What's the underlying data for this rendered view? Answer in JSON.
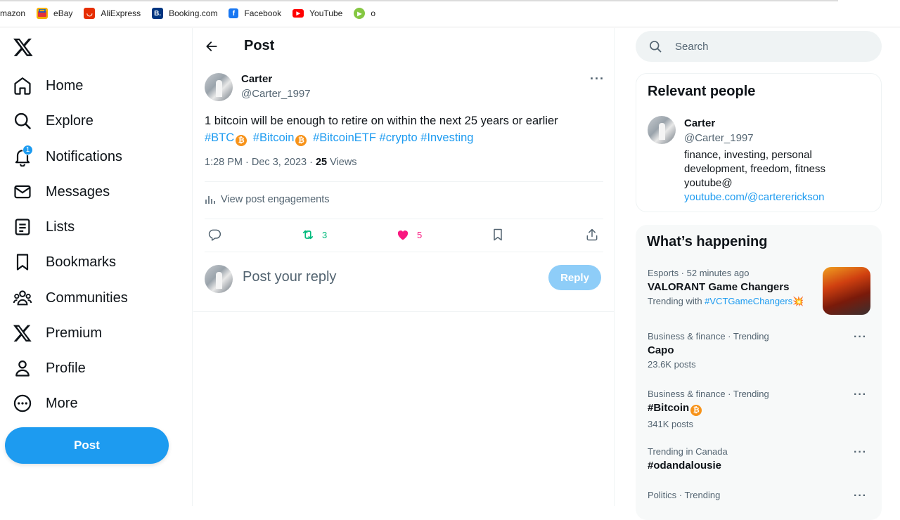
{
  "bookmarks_bar": {
    "items": [
      {
        "label": "mazon",
        "icon": "amazon-icon",
        "color": "#ff9900"
      },
      {
        "label": "eBay",
        "icon": "ebay-icon",
        "color": "#e53238"
      },
      {
        "label": "AliExpress",
        "icon": "aliexpress-icon",
        "color": "#e62e04"
      },
      {
        "label": "Booking.com",
        "icon": "booking-icon",
        "color": "#003580"
      },
      {
        "label": "Facebook",
        "icon": "facebook-icon",
        "color": "#1877f2"
      },
      {
        "label": "YouTube",
        "icon": "youtube-icon",
        "color": "#ff0000"
      },
      {
        "label": "o",
        "icon": "rumble-icon",
        "color": "#85c742"
      }
    ]
  },
  "nav": {
    "items": [
      {
        "label": "Home",
        "icon": "home-icon"
      },
      {
        "label": "Explore",
        "icon": "search-icon"
      },
      {
        "label": "Notifications",
        "icon": "bell-icon",
        "badge": "1"
      },
      {
        "label": "Messages",
        "icon": "envelope-icon"
      },
      {
        "label": "Lists",
        "icon": "list-icon"
      },
      {
        "label": "Bookmarks",
        "icon": "bookmark-icon"
      },
      {
        "label": "Communities",
        "icon": "people-icon"
      },
      {
        "label": "Premium",
        "icon": "x-logo-icon"
      },
      {
        "label": "Profile",
        "icon": "person-icon"
      },
      {
        "label": "More",
        "icon": "more-circle-icon"
      }
    ],
    "post_button": "Post"
  },
  "main": {
    "header_title": "Post",
    "author": {
      "name": "Carter",
      "handle": "@Carter_1997"
    },
    "text_line1": "1 bitcoin will be enough to retire on within the next 25 years or earlier",
    "hashtags": [
      "#BTC",
      "#Bitcoin",
      "#BitcoinETF",
      "#crypto",
      "#Investing"
    ],
    "bitcoin_emoji": "₿",
    "timestamp": "1:28 PM · Dec 3, 2023 · ",
    "views_count": "25",
    "views_label": " Views",
    "engagements_label": "View post engagements",
    "retweet_count": "3",
    "like_count": "5",
    "reply_placeholder": "Post your reply",
    "reply_button": "Reply",
    "colors": {
      "accent": "#1d9bf0",
      "retweet": "#00ba7c",
      "like": "#f91880"
    }
  },
  "right": {
    "search_placeholder": "Search",
    "relevant_people": {
      "title": "Relevant people",
      "name": "Carter",
      "handle": "@Carter_1997",
      "bio_line": "finance, investing, personal development, freedom, fitness youtube@",
      "bio_link": "youtube.com/@cartererickson"
    },
    "whats_happening": {
      "title": "What’s happening",
      "trends": [
        {
          "context": "Esports · 52 minutes ago",
          "name": "VALORANT Game Changers",
          "sub_prefix": "Trending with ",
          "sub_tag": "#VCTGameChangers",
          "sub_emoji": "💥"
        },
        {
          "context": "Business & finance · Trending",
          "name": "Capo",
          "sub": "23.6K posts"
        },
        {
          "context": "Business & finance · Trending",
          "name": "#Bitcoin",
          "sub": "341K posts"
        },
        {
          "context": "Trending in Canada",
          "name": "#odandalousie",
          "sub": ""
        },
        {
          "context": "Politics · Trending",
          "name": "",
          "sub": ""
        }
      ]
    }
  }
}
